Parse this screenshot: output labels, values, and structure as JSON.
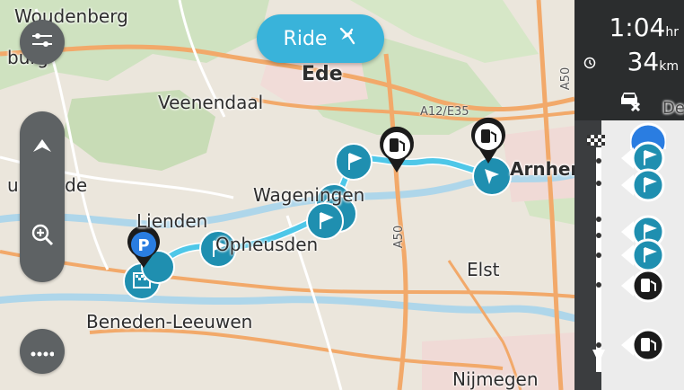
{
  "map": {
    "places": [
      {
        "name": "Woudenberg",
        "size": 20
      },
      {
        "name": "burg",
        "size": 20
      },
      {
        "name": "Ede",
        "size": 22
      },
      {
        "name": "Veenendaal",
        "size": 20
      },
      {
        "name": "uurstede",
        "size": 20
      },
      {
        "name": "Wageningen",
        "size": 20
      },
      {
        "name": "Lienden",
        "size": 20
      },
      {
        "name": "Opheusden",
        "size": 20
      },
      {
        "name": "Arnhem",
        "size": 20
      },
      {
        "name": "Elst",
        "size": 20
      },
      {
        "name": "Beneden-Leeuwen",
        "size": 20
      },
      {
        "name": "Nijmegen",
        "size": 20
      },
      {
        "name": "De S",
        "size": 18
      }
    ],
    "roads": [
      "A12/E35",
      "A50",
      "A50"
    ],
    "route_color": "#4ec7e8"
  },
  "ride_button": {
    "label": "Ride",
    "icon": "motorbike-icon"
  },
  "eta": {
    "time": "1:04",
    "time_unit": "hr",
    "distance": "34",
    "distance_unit": "km"
  },
  "icons": {
    "menu": "settings-sliders-icon",
    "zoom_in": "zoom-in-icon",
    "tilt": "chevron-up-icon",
    "more": "more-dots-icon",
    "traffic": "traffic-car-icon",
    "clock": "clock-icon",
    "finish": "checkered-flag-icon",
    "waypoint": "flag-icon",
    "fuel": "fuel-pump-icon",
    "parking": "parking-icon"
  },
  "colors": {
    "accent": "#39b3da",
    "waypoint": "#1f8fb0",
    "panel": "#3b3d3f",
    "parking": "#2a7de1"
  }
}
